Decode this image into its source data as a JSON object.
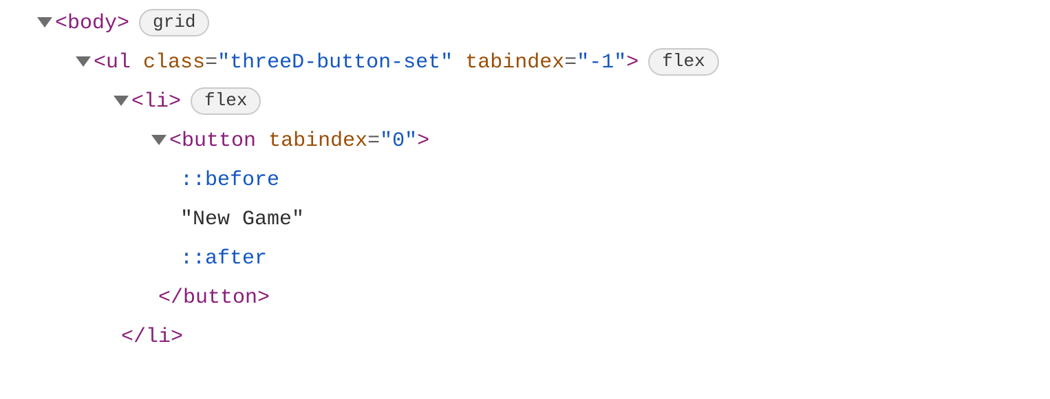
{
  "tree": {
    "line0": {
      "open": "<",
      "tag": "body",
      "close": ">",
      "badge": "grid"
    },
    "line1": {
      "open": "<",
      "tag": "ul",
      "attr1_name": "class",
      "attr1_eq": "=",
      "attr1_q1": "\"",
      "attr1_val": "threeD-button-set",
      "attr1_q2": "\"",
      "attr2_name": "tabindex",
      "attr2_eq": "=",
      "attr2_q1": "\"",
      "attr2_val": "-1",
      "attr2_q2": "\"",
      "close": ">",
      "badge": "flex"
    },
    "line2": {
      "open": "<",
      "tag": "li",
      "close": ">",
      "badge": "flex"
    },
    "line3": {
      "open": "<",
      "tag": "button",
      "attr1_name": "tabindex",
      "attr1_eq": "=",
      "attr1_q1": "\"",
      "attr1_val": "0",
      "attr1_q2": "\"",
      "close": ">"
    },
    "line4": {
      "pseudo": "::before"
    },
    "line5": {
      "text": "\"New Game\""
    },
    "line6": {
      "pseudo": "::after"
    },
    "line7": {
      "open": "</",
      "tag": "button",
      "close": ">"
    },
    "line8": {
      "open": "</",
      "tag": "li",
      "close": ">"
    }
  }
}
